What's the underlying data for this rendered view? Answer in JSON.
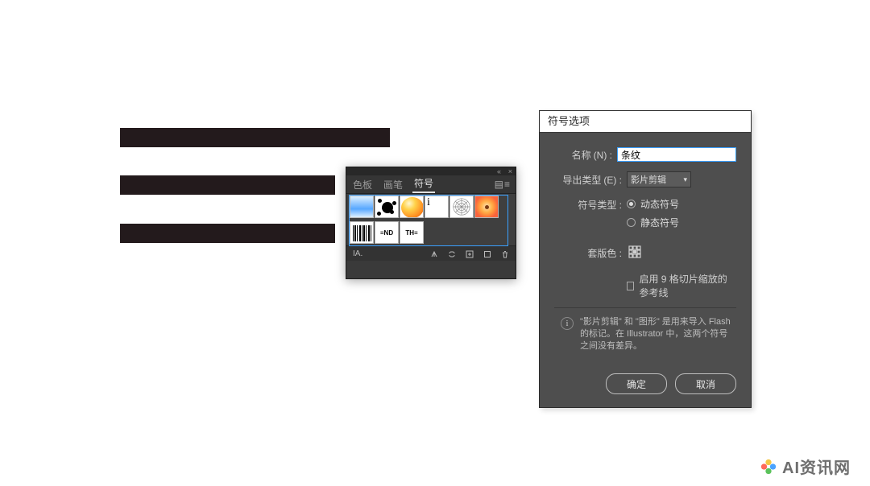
{
  "canvas": {
    "bars": 3
  },
  "symbols_panel": {
    "title_buttons": {
      "collapse": "«",
      "close": "×"
    },
    "tabs": [
      "色板",
      "画笔",
      "符号"
    ],
    "active_tab_index": 2,
    "menu_glyph": "▤≡",
    "swatches_row1": [
      "gradient",
      "ink",
      "orb",
      "char-i",
      "rosette",
      "flower"
    ],
    "swatches_row2": [
      "barcode",
      "end",
      "the"
    ],
    "row2_text": {
      "end": "≡ND",
      "the": "TH≡"
    },
    "char_swatch_label": "i",
    "footer_left": "IA."
  },
  "options_dialog": {
    "title": "符号选项",
    "name_label": "名称",
    "name_accel": "(N)",
    "name_value": "条纹",
    "export_label": "导出类型",
    "export_accel": "(E)",
    "export_selected": "影片剪辑",
    "symboltype_label": "符号类型",
    "radio1": "动态符号",
    "radio2": "静态符号",
    "radio_selected": 0,
    "regcolor_label": "套版色",
    "enable9_label": "启用 9 格切片缩放的参考线",
    "note_text": "\"影片剪辑\" 和 \"图形\" 是用来导入 Flash 的标记。在 Illustrator 中，这两个符号之间没有差异。",
    "ok_label": "确定",
    "cancel_label": "取消"
  },
  "watermark": {
    "text": "AI资讯网"
  }
}
